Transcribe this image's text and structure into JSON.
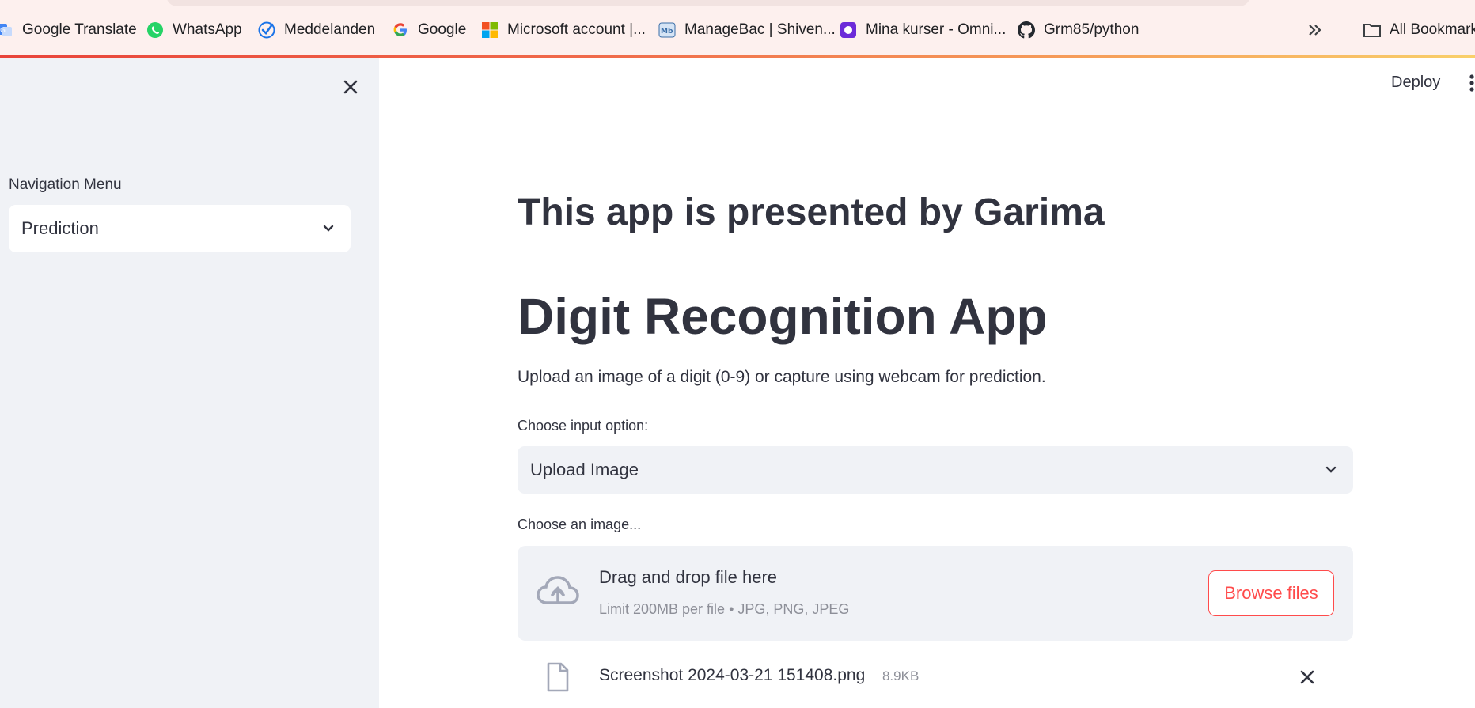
{
  "browser": {
    "bookmarks": [
      {
        "label": "Google Translate",
        "icon": "google-translate-icon"
      },
      {
        "label": "WhatsApp",
        "icon": "whatsapp-icon"
      },
      {
        "label": "Meddelanden",
        "icon": "checkmark-icon"
      },
      {
        "label": "Google",
        "icon": "google-icon"
      },
      {
        "label": "Microsoft account |...",
        "icon": "microsoft-icon"
      },
      {
        "label": "ManageBac | Shiven...",
        "icon": "managebac-icon"
      },
      {
        "label": "Mina kurser - Omni...",
        "icon": "omni-icon"
      },
      {
        "label": "Grm85/python",
        "icon": "github-icon"
      }
    ],
    "overflow_icon": "double-chevron-right-icon",
    "all_bookmarks_label": "All Bookmarks"
  },
  "sidebar": {
    "nav_label": "Navigation Menu",
    "nav_selected": "Prediction"
  },
  "header": {
    "deploy_label": "Deploy"
  },
  "main": {
    "presented_by": "This app is presented by Garima",
    "title": "Digit Recognition App",
    "description": "Upload an image of a digit (0-9) or capture using webcam for prediction.",
    "input_option_label": "Choose input option:",
    "input_option_selected": "Upload Image",
    "uploader": {
      "label": "Choose an image...",
      "drop_title": "Drag and drop file here",
      "limit_text": "Limit 200MB per file • JPG, PNG, JPEG",
      "browse_label": "Browse files"
    },
    "uploaded_file": {
      "name": "Screenshot 2024-03-21 151408.png",
      "size": "8.9KB"
    }
  },
  "colors": {
    "accent": "#ff4b4b",
    "sidebar_bg": "#f0f2f6",
    "text": "#31333f",
    "muted": "#8d8f98",
    "bookmarks_bg": "#fdf0ee"
  }
}
